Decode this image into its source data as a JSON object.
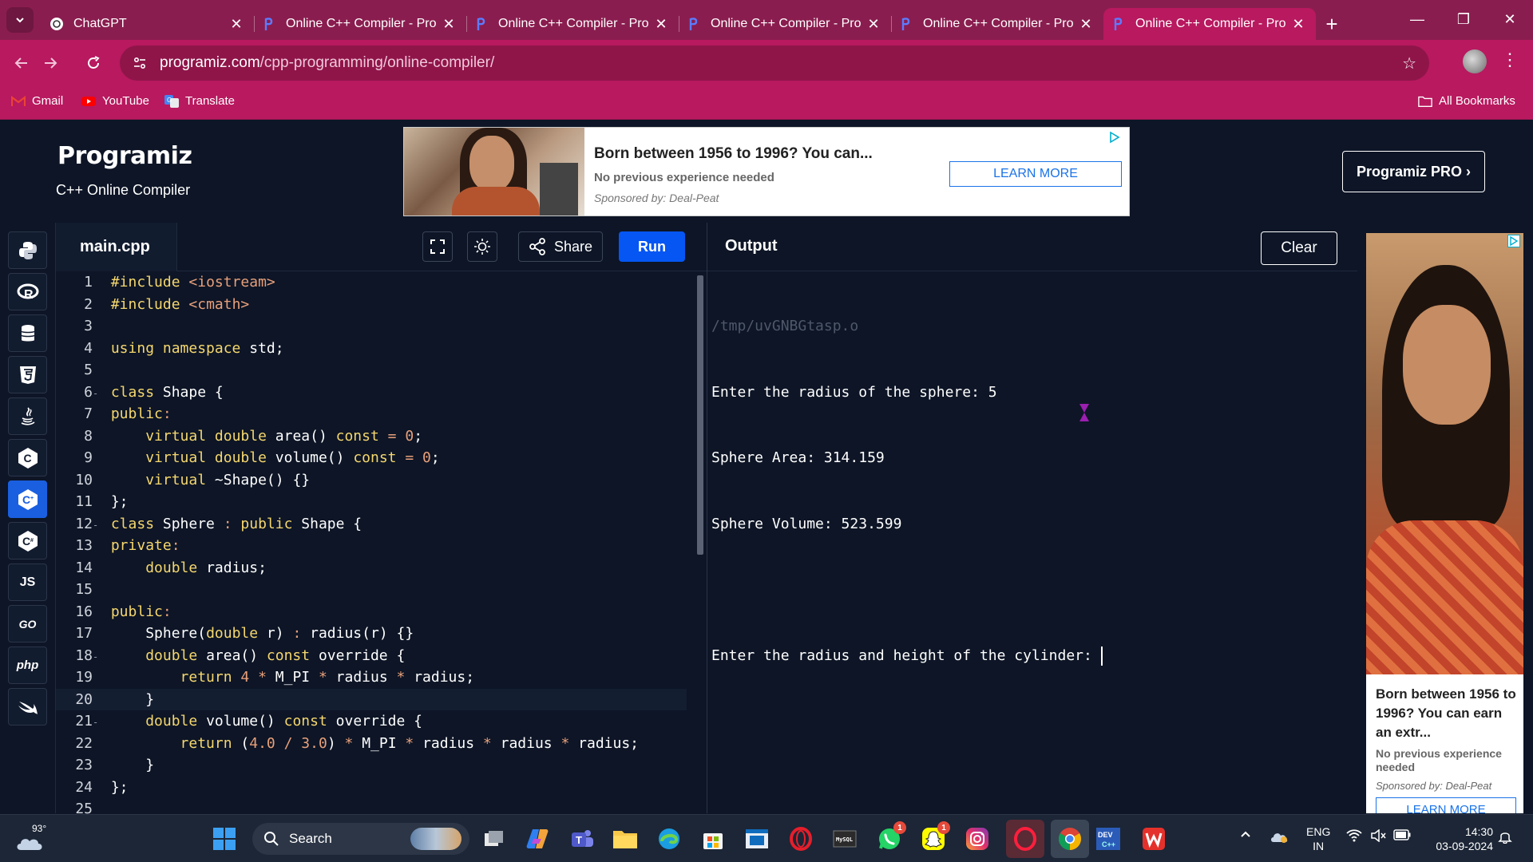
{
  "browser": {
    "tabs": [
      {
        "title": "ChatGPT",
        "favicon": "chatgpt-icon",
        "active": false
      },
      {
        "title": "Online C++ Compiler - Pro",
        "favicon": "programiz-icon",
        "active": false
      },
      {
        "title": "Online C++ Compiler - Pro",
        "favicon": "programiz-icon",
        "active": false
      },
      {
        "title": "Online C++ Compiler - Pro",
        "favicon": "programiz-icon",
        "active": false
      },
      {
        "title": "Online C++ Compiler - Pro",
        "favicon": "programiz-icon",
        "active": false
      },
      {
        "title": "Online C++ Compiler - Pro",
        "favicon": "programiz-icon",
        "active": true
      }
    ],
    "url_domain": "programiz.com",
    "url_path": "/cpp-programming/online-compiler/",
    "bookmarks": [
      {
        "label": "Gmail",
        "icon": "gmail-icon"
      },
      {
        "label": "YouTube",
        "icon": "youtube-icon"
      },
      {
        "label": "Translate",
        "icon": "translate-icon"
      }
    ],
    "all_bookmarks": "All Bookmarks",
    "theme_colors": {
      "tabstrip": "#8a1d4f",
      "toolbar": "#b8195f"
    }
  },
  "site": {
    "logo": "Programiz",
    "subtitle": "C++ Online Compiler",
    "pro_button": "Programiz PRO ›",
    "top_ad": {
      "headline": "Born between 1956 to 1996? You can...",
      "description": "No previous experience needed",
      "sponsor": "Sponsored by: Deal-Peat",
      "cta": "LEARN MORE"
    },
    "side_ad": {
      "headline": "Born between 1956 to 1996? You can earn an extr...",
      "description": "No previous experience needed",
      "sponsor": "Sponsored by: Deal-Peat",
      "cta": "LEARN MORE"
    }
  },
  "rail": [
    {
      "name": "python",
      "label": ""
    },
    {
      "name": "r",
      "label": "R"
    },
    {
      "name": "sql",
      "label": ""
    },
    {
      "name": "html",
      "label": "5"
    },
    {
      "name": "java",
      "label": ""
    },
    {
      "name": "c",
      "label": "C"
    },
    {
      "name": "cpp",
      "label": "C",
      "active": true
    },
    {
      "name": "csharp",
      "label": "C"
    },
    {
      "name": "js",
      "label": "JS"
    },
    {
      "name": "go",
      "label": "GO"
    },
    {
      "name": "php",
      "label": "php"
    },
    {
      "name": "swift",
      "label": ""
    }
  ],
  "editor": {
    "file_name": "main.cpp",
    "share_label": "Share",
    "run_label": "Run",
    "accent": "#0556f3",
    "lines": [
      {
        "n": "1",
        "fold": "",
        "tokens": [
          [
            "kw",
            "#include "
          ],
          [
            "str",
            "<iostream>"
          ]
        ]
      },
      {
        "n": "2",
        "fold": "",
        "tokens": [
          [
            "kw",
            "#include "
          ],
          [
            "str",
            "<cmath>"
          ]
        ]
      },
      {
        "n": "3",
        "fold": "",
        "tokens": []
      },
      {
        "n": "4",
        "fold": "",
        "tokens": [
          [
            "kw",
            "using namespace "
          ],
          [
            "src",
            "std;"
          ]
        ]
      },
      {
        "n": "5",
        "fold": "",
        "tokens": []
      },
      {
        "n": "6",
        "fold": "-",
        "tokens": [
          [
            "kw",
            "class "
          ],
          [
            "src",
            "Shape {"
          ]
        ]
      },
      {
        "n": "7",
        "fold": "",
        "tokens": [
          [
            "kw",
            "public"
          ],
          [
            "op",
            ":"
          ]
        ]
      },
      {
        "n": "8",
        "fold": "",
        "tokens": [
          [
            "src",
            "    "
          ],
          [
            "kw",
            "virtual double "
          ],
          [
            "src",
            "area() "
          ],
          [
            "kw",
            "const "
          ],
          [
            "op",
            "= "
          ],
          [
            "num",
            "0"
          ],
          [
            "src",
            ";"
          ]
        ]
      },
      {
        "n": "9",
        "fold": "",
        "tokens": [
          [
            "src",
            "    "
          ],
          [
            "kw",
            "virtual double "
          ],
          [
            "src",
            "volume() "
          ],
          [
            "kw",
            "const "
          ],
          [
            "op",
            "= "
          ],
          [
            "num",
            "0"
          ],
          [
            "src",
            ";"
          ]
        ]
      },
      {
        "n": "10",
        "fold": "",
        "tokens": [
          [
            "src",
            "    "
          ],
          [
            "kw",
            "virtual "
          ],
          [
            "src",
            "~Shape() {}"
          ]
        ]
      },
      {
        "n": "11",
        "fold": "",
        "tokens": [
          [
            "src",
            "};"
          ]
        ]
      },
      {
        "n": "12",
        "fold": "-",
        "tokens": [
          [
            "kw",
            "class "
          ],
          [
            "src",
            "Sphere "
          ],
          [
            "op",
            ": "
          ],
          [
            "kw",
            "public "
          ],
          [
            "src",
            "Shape {"
          ]
        ]
      },
      {
        "n": "13",
        "fold": "",
        "tokens": [
          [
            "kw",
            "private"
          ],
          [
            "op",
            ":"
          ]
        ]
      },
      {
        "n": "14",
        "fold": "",
        "tokens": [
          [
            "src",
            "    "
          ],
          [
            "kw",
            "double "
          ],
          [
            "src",
            "radius;"
          ]
        ]
      },
      {
        "n": "15",
        "fold": "",
        "tokens": []
      },
      {
        "n": "16",
        "fold": "",
        "tokens": [
          [
            "kw",
            "public"
          ],
          [
            "op",
            ":"
          ]
        ]
      },
      {
        "n": "17",
        "fold": "",
        "tokens": [
          [
            "src",
            "    Sphere("
          ],
          [
            "kw",
            "double "
          ],
          [
            "src",
            "r) "
          ],
          [
            "op",
            ": "
          ],
          [
            "src",
            "radius(r) {}"
          ]
        ]
      },
      {
        "n": "18",
        "fold": "-",
        "tokens": [
          [
            "src",
            "    "
          ],
          [
            "kw",
            "double "
          ],
          [
            "src",
            "area() "
          ],
          [
            "kw",
            "const "
          ],
          [
            "src",
            "override {"
          ]
        ]
      },
      {
        "n": "19",
        "fold": "",
        "tokens": [
          [
            "src",
            "        "
          ],
          [
            "kw",
            "return "
          ],
          [
            "num",
            "4 "
          ],
          [
            "op",
            "* "
          ],
          [
            "src",
            "M_PI "
          ],
          [
            "op",
            "* "
          ],
          [
            "src",
            "radius "
          ],
          [
            "op",
            "* "
          ],
          [
            "src",
            "radius;"
          ]
        ]
      },
      {
        "n": "20",
        "fold": "",
        "highlight": true,
        "tokens": [
          [
            "src",
            "    }"
          ]
        ]
      },
      {
        "n": "21",
        "fold": "-",
        "tokens": [
          [
            "src",
            "    "
          ],
          [
            "kw",
            "double "
          ],
          [
            "src",
            "volume() "
          ],
          [
            "kw",
            "const "
          ],
          [
            "src",
            "override {"
          ]
        ]
      },
      {
        "n": "22",
        "fold": "",
        "tokens": [
          [
            "src",
            "        "
          ],
          [
            "kw",
            "return "
          ],
          [
            "src",
            "("
          ],
          [
            "num",
            "4.0 "
          ],
          [
            "op",
            "/ "
          ],
          [
            "num",
            "3.0"
          ],
          [
            "src",
            ") "
          ],
          [
            "op",
            "* "
          ],
          [
            "src",
            "M_PI "
          ],
          [
            "op",
            "* "
          ],
          [
            "src",
            "radius "
          ],
          [
            "op",
            "* "
          ],
          [
            "src",
            "radius "
          ],
          [
            "op",
            "* "
          ],
          [
            "src",
            "radius;"
          ]
        ]
      },
      {
        "n": "23",
        "fold": "",
        "tokens": [
          [
            "src",
            "    }"
          ]
        ]
      },
      {
        "n": "24",
        "fold": "",
        "tokens": [
          [
            "src",
            "};"
          ]
        ]
      },
      {
        "n": "25",
        "fold": "",
        "tokens": []
      }
    ]
  },
  "output": {
    "title": "Output",
    "clear_label": "Clear",
    "path": "/tmp/uvGNBGtasp.o",
    "lines": [
      "Enter the radius of the sphere: 5",
      "Sphere Area: 314.159",
      "Sphere Volume: 523.599",
      "",
      "Enter the radius and height of the cylinder: "
    ]
  },
  "taskbar": {
    "temperature": "93°",
    "search_label": "Search",
    "apps": [
      {
        "name": "start",
        "badge": ""
      },
      {
        "name": "task-view",
        "badge": ""
      },
      {
        "name": "copilot",
        "badge": ""
      },
      {
        "name": "teams",
        "badge": ""
      },
      {
        "name": "file-explorer",
        "badge": ""
      },
      {
        "name": "edge",
        "badge": ""
      },
      {
        "name": "store",
        "badge": ""
      },
      {
        "name": "notepad",
        "badge": ""
      },
      {
        "name": "opera",
        "badge": ""
      },
      {
        "name": "mysql",
        "badge": ""
      },
      {
        "name": "whatsapp",
        "badge": "1"
      },
      {
        "name": "snapchat",
        "badge": "1"
      },
      {
        "name": "instagram",
        "badge": ""
      },
      {
        "name": "opera-gx",
        "badge": ""
      },
      {
        "name": "chrome",
        "badge": ""
      },
      {
        "name": "dev-cpp",
        "badge": ""
      },
      {
        "name": "wps-office",
        "badge": ""
      }
    ],
    "lang_top": "ENG",
    "lang_bottom": "IN",
    "time": "14:30",
    "date": "03-09-2024"
  }
}
